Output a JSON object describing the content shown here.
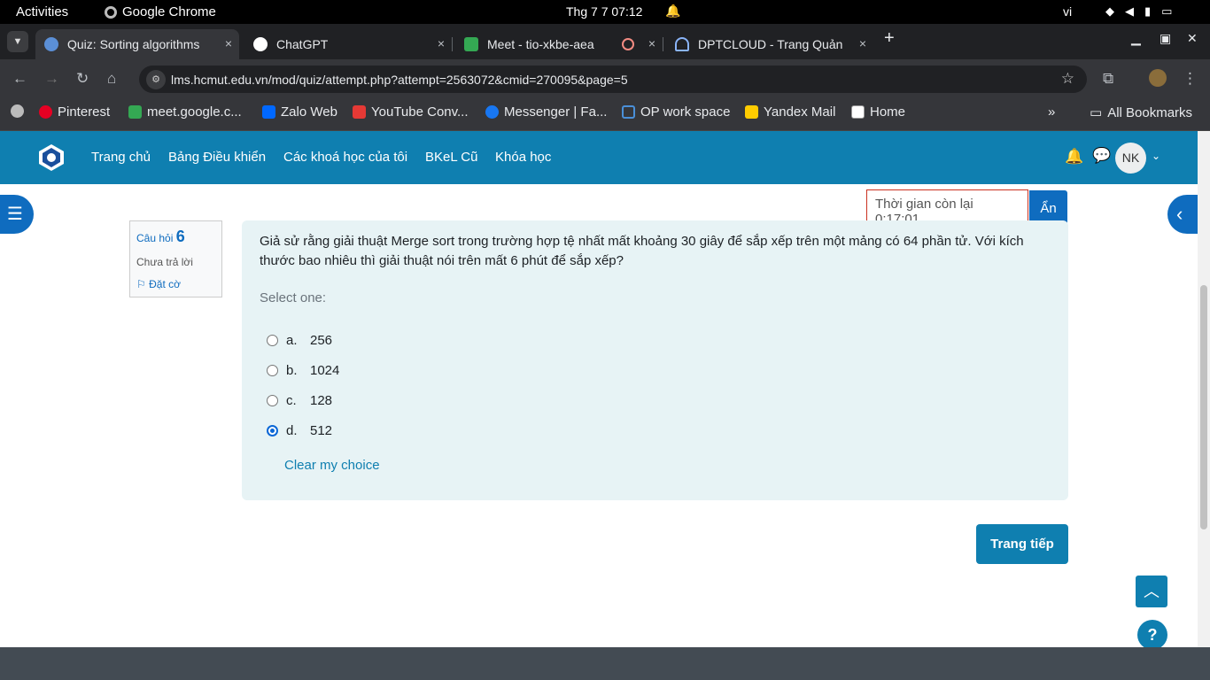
{
  "os": {
    "activities": "Activities",
    "app_name": "Google Chrome",
    "clock": "Thg 7 7  07:12",
    "lang": "vi"
  },
  "tabs": [
    {
      "title": "Quiz: Sorting algorithms",
      "close": "×"
    },
    {
      "title": "ChatGPT",
      "close": "×"
    },
    {
      "title": "Meet - tio-xkbe-aea",
      "close": "×"
    },
    {
      "title": "DPTCLOUD - Trang Quản",
      "close": "×"
    }
  ],
  "address": {
    "url": "lms.hcmut.edu.vn/mod/quiz/attempt.php?attempt=2563072&cmid=270095&page=5"
  },
  "bookmarks": [
    "Pinterest",
    "meet.google.c...",
    "Zalo Web",
    "YouTube Conv...",
    "Messenger | Fa...",
    "OP work space",
    "Yandex Mail",
    "Home"
  ],
  "bookmarks_more": "»",
  "all_bookmarks": "All Bookmarks",
  "site_nav": {
    "items": [
      "Trang chủ",
      "Bảng Điều khiển",
      "Các khoá học của tôi",
      "BKeL Cũ",
      "Khóa học"
    ],
    "avatar": "NK"
  },
  "timer": {
    "label": "Thời gian còn lại 0:17:01",
    "hide": "Ẩn"
  },
  "question_info": {
    "label": "Câu hỏi",
    "number": "6",
    "state": "Chưa trả lời",
    "flag": "Đặt cờ"
  },
  "question": {
    "text": "Giả sử rằng giải thuật Merge sort trong trường hợp tệ nhất mất khoảng 30 giây để sắp xếp trên một mảng có 64 phần tử. Với kích thước bao nhiêu thì giải thuật nói trên mất 6 phút để sắp xếp?",
    "prompt": "Select one:",
    "options": [
      {
        "letter": "a.",
        "value": "256",
        "selected": false
      },
      {
        "letter": "b.",
        "value": "1024",
        "selected": false
      },
      {
        "letter": "c.",
        "value": "128",
        "selected": false
      },
      {
        "letter": "d.",
        "value": "512",
        "selected": true
      }
    ],
    "clear": "Clear my choice"
  },
  "next_button": "Trang tiếp",
  "help": "?",
  "colors": {
    "brand": "#0f7fb0",
    "primary": "#0f6cbf",
    "question_bg": "#e7f3f5",
    "timer_border": "#ca3120"
  }
}
